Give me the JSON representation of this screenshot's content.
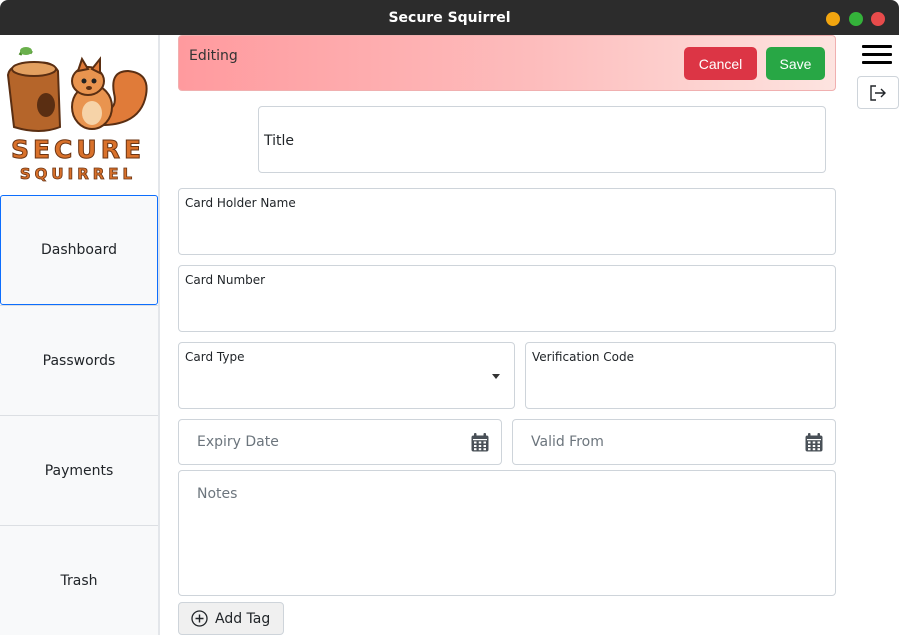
{
  "window": {
    "title": "Secure Squirrel"
  },
  "logo": {
    "line1": "SECURE",
    "line2": "SQUIRREL"
  },
  "sidebar": {
    "items": [
      {
        "label": "Dashboard"
      },
      {
        "label": "Passwords"
      },
      {
        "label": "Payments"
      },
      {
        "label": "Trash"
      }
    ]
  },
  "banner": {
    "label": "Editing",
    "cancel": "Cancel",
    "save": "Save"
  },
  "form": {
    "title": "Title",
    "card_holder": "Card Holder Name",
    "card_number": "Card Number",
    "card_type": "Card Type",
    "verification_code": "Verification Code",
    "expiry_placeholder": "Expiry Date",
    "valid_from_placeholder": "Valid From",
    "notes_placeholder": "Notes",
    "add_tag": "Add Tag"
  },
  "colors": {
    "cancel": "#dc3545",
    "save": "#28a745",
    "banner_start": "#ff9a9e",
    "logo_orange": "#d9712b"
  }
}
